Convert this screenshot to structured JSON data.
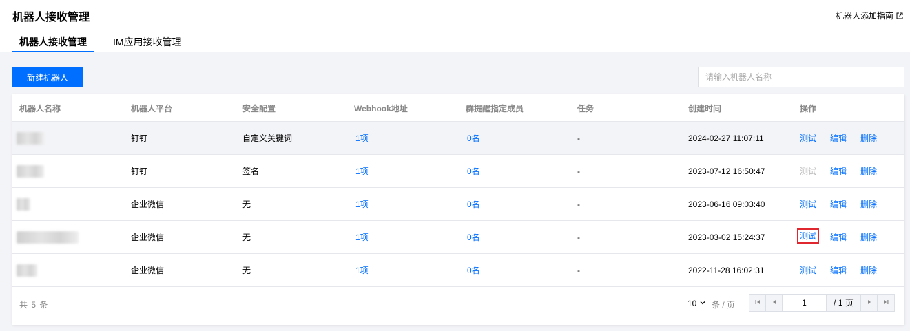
{
  "header": {
    "title": "机器人接收管理",
    "guide_link": "机器人添加指南"
  },
  "tabs": [
    {
      "label": "机器人接收管理",
      "active": true
    },
    {
      "label": "IM应用接收管理",
      "active": false
    }
  ],
  "toolbar": {
    "new_button": "新建机器人",
    "search_placeholder": "请输入机器人名称"
  },
  "table": {
    "columns": [
      "机器人名称",
      "机器人平台",
      "安全配置",
      "Webhook地址",
      "群提醒指定成员",
      "任务",
      "创建时间",
      "操作"
    ],
    "rows": [
      {
        "platform": "钉钉",
        "security": "自定义关键词",
        "webhook": "1项",
        "members": "0名",
        "task": "-",
        "created": "2024-02-27 11:07:11",
        "test": "测试",
        "test_disabled": false,
        "edit": "编辑",
        "delete": "删除"
      },
      {
        "platform": "钉钉",
        "security": "签名",
        "webhook": "1项",
        "members": "0名",
        "task": "-",
        "created": "2023-07-12 16:50:47",
        "test": "测试",
        "test_disabled": true,
        "edit": "编辑",
        "delete": "删除"
      },
      {
        "platform": "企业微信",
        "security": "无",
        "webhook": "1项",
        "members": "0名",
        "task": "-",
        "created": "2023-06-16 09:03:40",
        "test": "测试",
        "test_disabled": false,
        "edit": "编辑",
        "delete": "删除"
      },
      {
        "platform": "企业微信",
        "security": "无",
        "webhook": "1项",
        "members": "0名",
        "task": "-",
        "created": "2023-03-02 15:24:37",
        "test": "测试",
        "test_disabled": false,
        "edit": "编辑",
        "delete": "删除"
      },
      {
        "platform": "企业微信",
        "security": "无",
        "webhook": "1项",
        "members": "0名",
        "task": "-",
        "created": "2022-11-28 16:02:31",
        "test": "测试",
        "test_disabled": false,
        "edit": "编辑",
        "delete": "删除"
      }
    ]
  },
  "pagination": {
    "total_text": "共 5 条",
    "page_size": "10",
    "per_page_label": "条 / 页",
    "current_page": "1",
    "total_pages": "/ 1 页"
  },
  "colors": {
    "accent": "#006eff",
    "highlight_border": "#e0262e"
  }
}
